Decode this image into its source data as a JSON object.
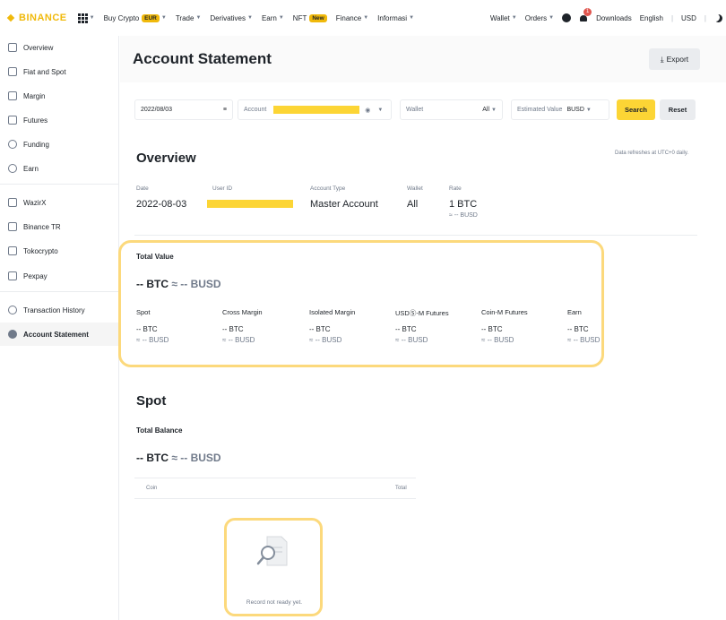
{
  "nav": {
    "brand": "BINANCE",
    "items": [
      {
        "label": "Buy Crypto",
        "pill": "EUR",
        "caret": true
      },
      {
        "label": "Trade",
        "caret": true
      },
      {
        "label": "Derivatives",
        "caret": true
      },
      {
        "label": "Earn",
        "caret": true
      },
      {
        "label": "NFT",
        "pill": "New",
        "caret": false
      },
      {
        "label": "Finance",
        "caret": true
      },
      {
        "label": "Informasi",
        "caret": true
      }
    ],
    "wallet": "Wallet",
    "orders": "Orders",
    "notifications_count": "1",
    "downloads": "Downloads",
    "language": "English",
    "divider": "|",
    "currency": "USD",
    "icons": [
      "grid-icon",
      "user-icon",
      "bell-icon",
      "moon-icon"
    ]
  },
  "sidebar": {
    "items": [
      {
        "label": "Overview",
        "icon": "overview-icon"
      },
      {
        "label": "Fiat and Spot",
        "icon": "fiat-spot-icon"
      },
      {
        "label": "Margin",
        "icon": "margin-icon"
      },
      {
        "label": "Futures",
        "icon": "futures-icon"
      },
      {
        "label": "Funding",
        "icon": "funding-icon"
      },
      {
        "label": "Earn",
        "icon": "earn-icon"
      },
      {
        "label": "WazirX",
        "icon": "wallet-icon"
      },
      {
        "label": "Binance TR",
        "icon": "wallet-icon"
      },
      {
        "label": "Tokocrypto",
        "icon": "wallet-icon"
      },
      {
        "label": "Pexpay",
        "icon": "wallet-icon"
      },
      {
        "label": "Transaction History",
        "icon": "history-icon"
      },
      {
        "label": "Account Statement",
        "icon": "statement-icon",
        "active": true
      }
    ]
  },
  "page": {
    "title": "Account Statement",
    "export": "Export"
  },
  "filters": {
    "date": "2022/08/03",
    "account_label": "Account",
    "wallet_placeholder": "Wallet",
    "wallet_value": "All",
    "estimated_label": "Estimated Value",
    "estimated_value": "BUSD",
    "search": "Search",
    "reset": "Reset"
  },
  "overview": {
    "title": "Overview",
    "note": "Data refreshes at UTC+0 daily.",
    "date_label": "Date",
    "date_value": "2022-08-03",
    "user_id_label": "User ID",
    "account_type_label": "Account Type",
    "account_type_value": "Master Account",
    "wallet_label": "Wallet",
    "wallet_value": "All",
    "rate_label": "Rate",
    "rate_value": "1 BTC",
    "rate_sub": "≈ -- BUSD"
  },
  "total_value": {
    "label": "Total Value",
    "btc": "-- BTC",
    "busd": "≈ -- BUSD",
    "columns": [
      {
        "name": "Spot",
        "btc": "-- BTC",
        "busd": "≈ -- BUSD"
      },
      {
        "name": "Cross Margin",
        "btc": "-- BTC",
        "busd": "≈ -- BUSD"
      },
      {
        "name": "Isolated Margin",
        "btc": "-- BTC",
        "busd": "≈ -- BUSD"
      },
      {
        "name": "USDⓈ-M Futures",
        "btc": "-- BTC",
        "busd": "≈ -- BUSD"
      },
      {
        "name": "Coin-M Futures",
        "btc": "-- BTC",
        "busd": "≈ -- BUSD"
      },
      {
        "name": "Earn",
        "btc": "-- BTC",
        "busd": "≈ -- BUSD"
      }
    ]
  },
  "spot": {
    "title": "Spot",
    "total_balance_label": "Total Balance",
    "btc": "-- BTC",
    "busd": "≈ -- BUSD",
    "table_headers": [
      "Coin",
      "Total"
    ],
    "empty_text": "Record not ready yet."
  },
  "colors": {
    "accent": "#fcd535",
    "brand": "#f0b90b",
    "highlight": "#fcd97c"
  }
}
